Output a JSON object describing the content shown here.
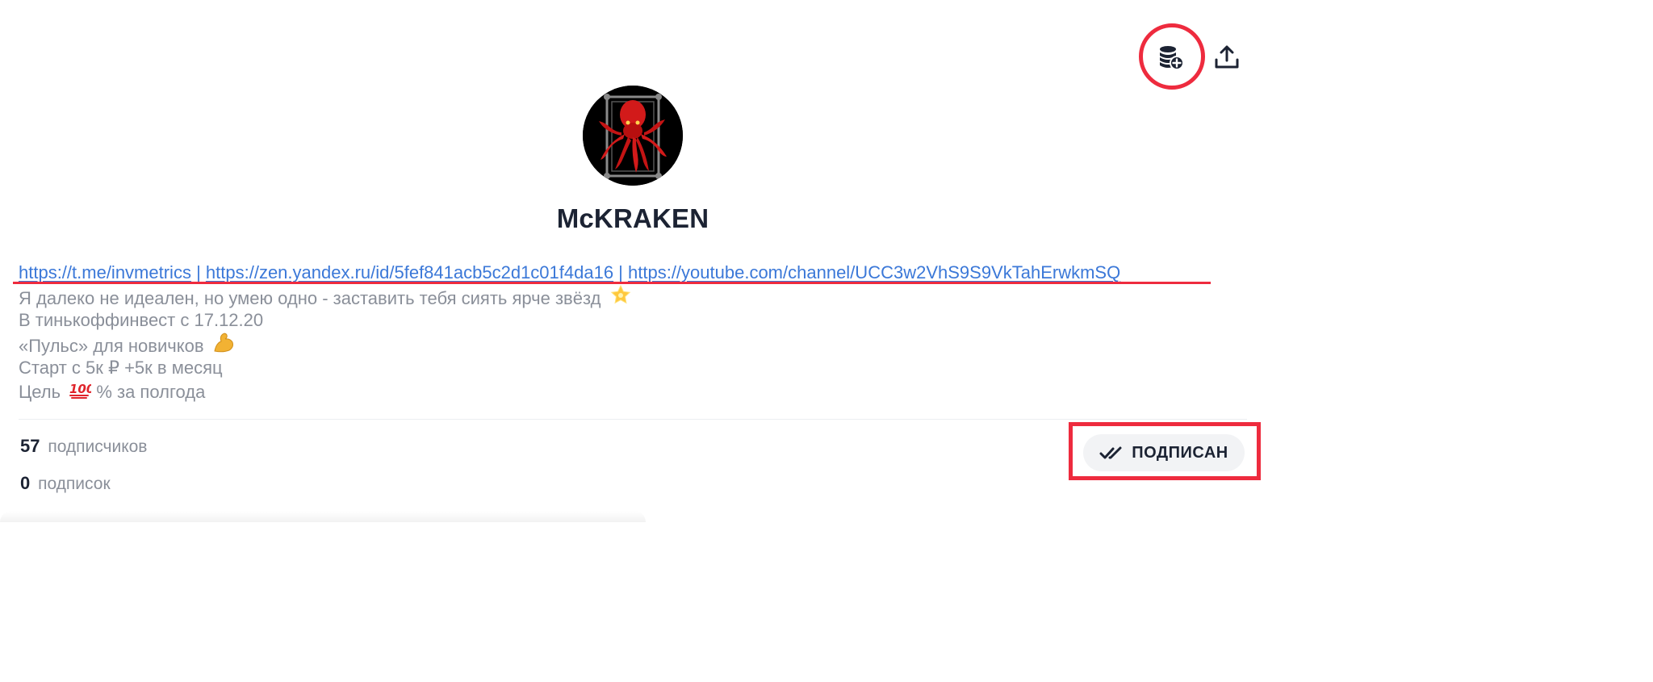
{
  "profile": {
    "name": "McKRAKEN",
    "links": [
      "https://t.me/invmetrics",
      "https://zen.yandex.ru/id/5fef841acb5c2d1c01f4da16",
      "https://youtube.com/channel/UCC3w2VhS9S9VkTahErwkmSQ"
    ],
    "link_separator": " | ",
    "bio_lines": [
      "Я далеко не идеален, но умею одно - заставить тебя сиять ярче звёзд",
      "В тинькоффинвест с 17.12.20",
      "«Пульс» для новичков",
      "Старт с 5к ₽ +5к в месяц",
      "Цель",
      "% за полгода"
    ],
    "followers_count": "57",
    "followers_label": "подписчиков",
    "following_count": "0",
    "following_label": "подписок"
  },
  "actions": {
    "subscribe_label": "ПОДПИСАН"
  },
  "icons": {
    "coins": "coins-plus-icon",
    "share": "share-upload-icon",
    "star": "glowing-star-emoji",
    "muscle": "flexed-biceps-emoji",
    "hundred": "hundred-points-emoji",
    "check": "double-check-icon"
  },
  "colors": {
    "accent_link": "#3b78d8",
    "annotation_red": "#ee2b3e",
    "text_dark": "#1c2333",
    "text_muted": "#8a8f99"
  }
}
